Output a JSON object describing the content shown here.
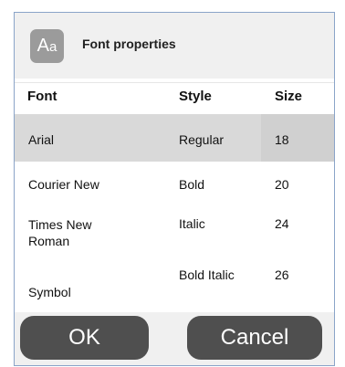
{
  "dialog": {
    "icon_big": "A",
    "icon_small": "a",
    "title": "Font properties"
  },
  "columns": {
    "font": "Font",
    "style": "Style",
    "size": "Size"
  },
  "fonts": [
    "Arial",
    "Courier New",
    "Times New Roman",
    "Symbol"
  ],
  "styles": [
    "Regular",
    "Bold",
    "Italic",
    "Bold Italic"
  ],
  "sizes": [
    "18",
    "20",
    "24",
    "26"
  ],
  "selected": {
    "font": "Arial",
    "style": "Regular",
    "size": "18"
  },
  "buttons": {
    "ok": "OK",
    "cancel": "Cancel"
  },
  "colors": {
    "selection": "#d9d9d9",
    "button": "#4f4f4f",
    "border": "#8aa4c8"
  },
  "icons": {
    "app": "font-aa-icon"
  }
}
